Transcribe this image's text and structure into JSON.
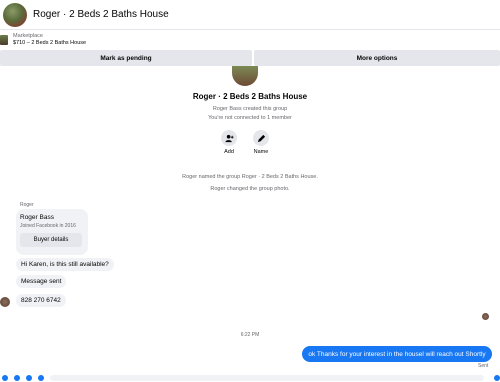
{
  "header": {
    "title": "Roger · 2 Beds 2 Baths House"
  },
  "marketplace": {
    "label": "Marketplace",
    "listing": "$710 – 2 Beds 2 Baths House"
  },
  "actions_bar": {
    "pending": "Mark as pending",
    "more": "More options"
  },
  "group": {
    "name": "Roger · 2 Beds 2 Baths House",
    "created": "Roger Bass created this group",
    "connection": "You're not connected to 1 member",
    "add_label": "Add",
    "name_label": "Name"
  },
  "system_messages": [
    "Roger named the group Roger · 2 Beds 2 Baths House.",
    "Roger changed the group photo."
  ],
  "incoming": {
    "sender": "Roger",
    "card": {
      "name": "Roger Bass",
      "joined": "Joined Facebook in 2016",
      "details_button": "Buyer details"
    },
    "messages": [
      "Hi Karen, is this still available?",
      "Message sent",
      "828 270 6742"
    ]
  },
  "timestamp": "6:22 PM",
  "outgoing": {
    "text": "ok Thanks for your interest in the housel will reach out Shortly",
    "status": "Sent"
  },
  "colors": {
    "accent": "#1877f2",
    "bubble": "#f0f2f5",
    "button": "#e4e6eb"
  },
  "icons": {
    "add": "add-person-icon",
    "name": "pencil-icon"
  }
}
